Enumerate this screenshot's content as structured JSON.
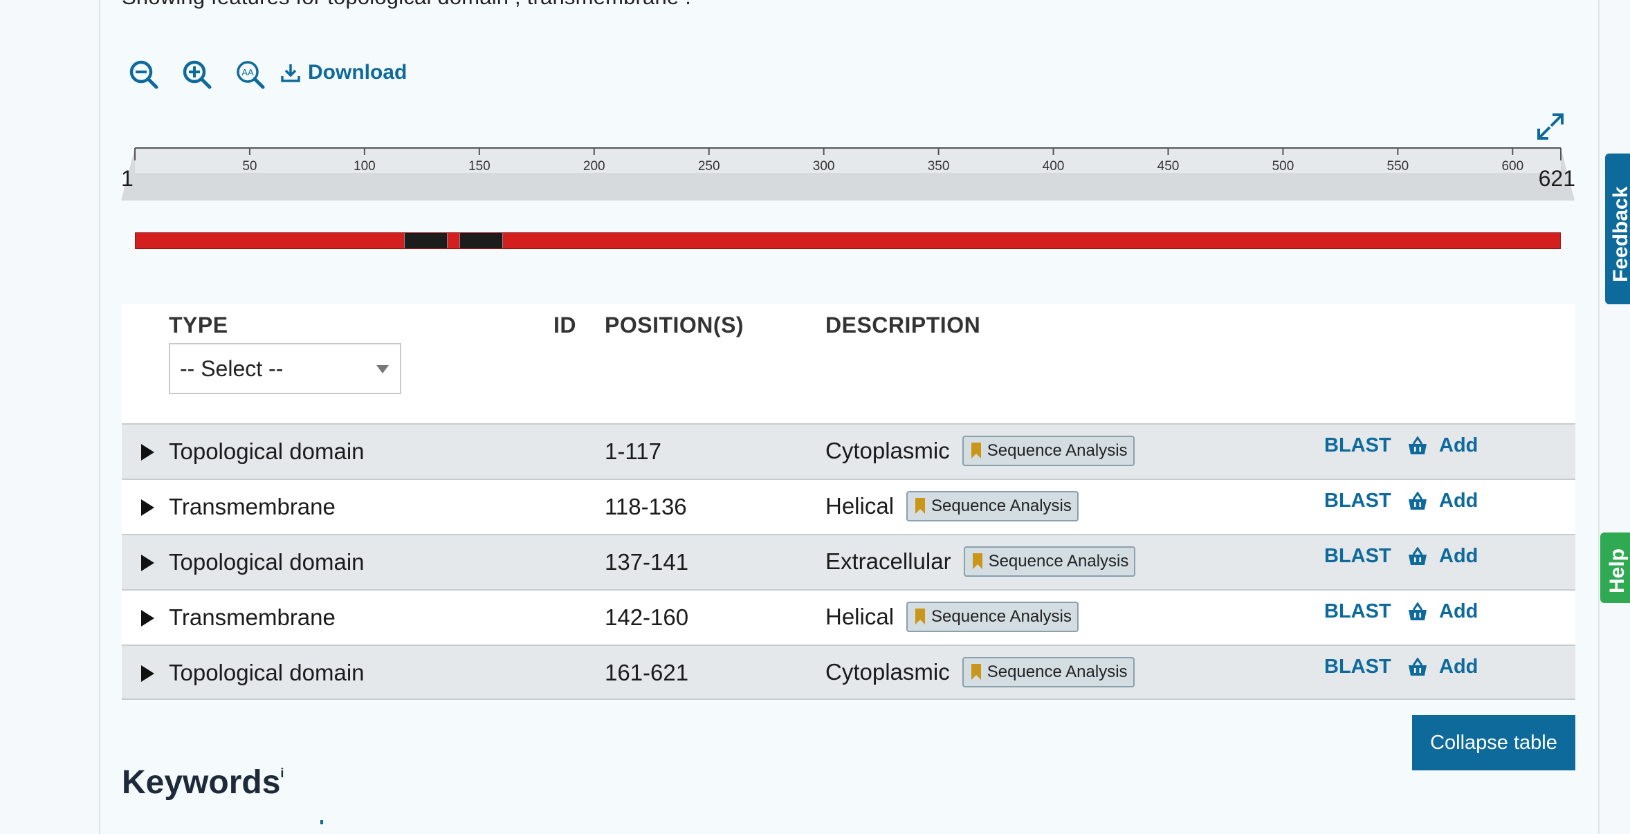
{
  "intro": {
    "text": "Showing features for topological domain , transmembrane ."
  },
  "toolbar": {
    "zoom_out_icon": "zoom-out-icon",
    "zoom_in_icon": "zoom-in-icon",
    "zoom_reset_icon": "zoom-reset-icon",
    "download_label": "Download",
    "fullscreen_icon": "fullscreen-icon"
  },
  "ruler": {
    "start": "1",
    "end": "621",
    "ticks": [
      "50",
      "100",
      "150",
      "200",
      "250",
      "300",
      "350",
      "400",
      "450",
      "500",
      "550",
      "600"
    ]
  },
  "track": {
    "length": 621,
    "segments": [
      {
        "start": 118,
        "end": 136
      },
      {
        "start": 142,
        "end": 160
      }
    ],
    "colors": {
      "domain": "#d41f1f",
      "transmembrane": "#1c1c1c"
    }
  },
  "table": {
    "headers": {
      "type": "TYPE",
      "id": "ID",
      "positions": "POSITION(S)",
      "description": "DESCRIPTION"
    },
    "type_filter": "-- Select --",
    "rows": [
      {
        "type": "Topological domain",
        "id": "",
        "positions": "1-117",
        "description": "Cytoplasmic",
        "evidence": "Sequence Analysis",
        "blast": "BLAST",
        "add": "Add"
      },
      {
        "type": "Transmembrane",
        "id": "",
        "positions": "118-136",
        "description": "Helical",
        "evidence": "Sequence Analysis",
        "blast": "BLAST",
        "add": "Add"
      },
      {
        "type": "Topological domain",
        "id": "",
        "positions": "137-141",
        "description": "Extracellular",
        "evidence": "Sequence Analysis",
        "blast": "BLAST",
        "add": "Add"
      },
      {
        "type": "Transmembrane",
        "id": "",
        "positions": "142-160",
        "description": "Helical",
        "evidence": "Sequence Analysis",
        "blast": "BLAST",
        "add": "Add"
      },
      {
        "type": "Topological domain",
        "id": "",
        "positions": "161-621",
        "description": "Cytoplasmic",
        "evidence": "Sequence Analysis",
        "blast": "BLAST",
        "add": "Add"
      }
    ],
    "collapse_label": "Collapse table"
  },
  "keywords": {
    "title": "Keywords",
    "info_mark": "i"
  },
  "side_tabs": {
    "feedback": "Feedback",
    "help": "Help"
  },
  "colors": {
    "accent": "#0e6a9b",
    "help_tab": "#2faa52",
    "evidence_icon": "#c9961a"
  }
}
